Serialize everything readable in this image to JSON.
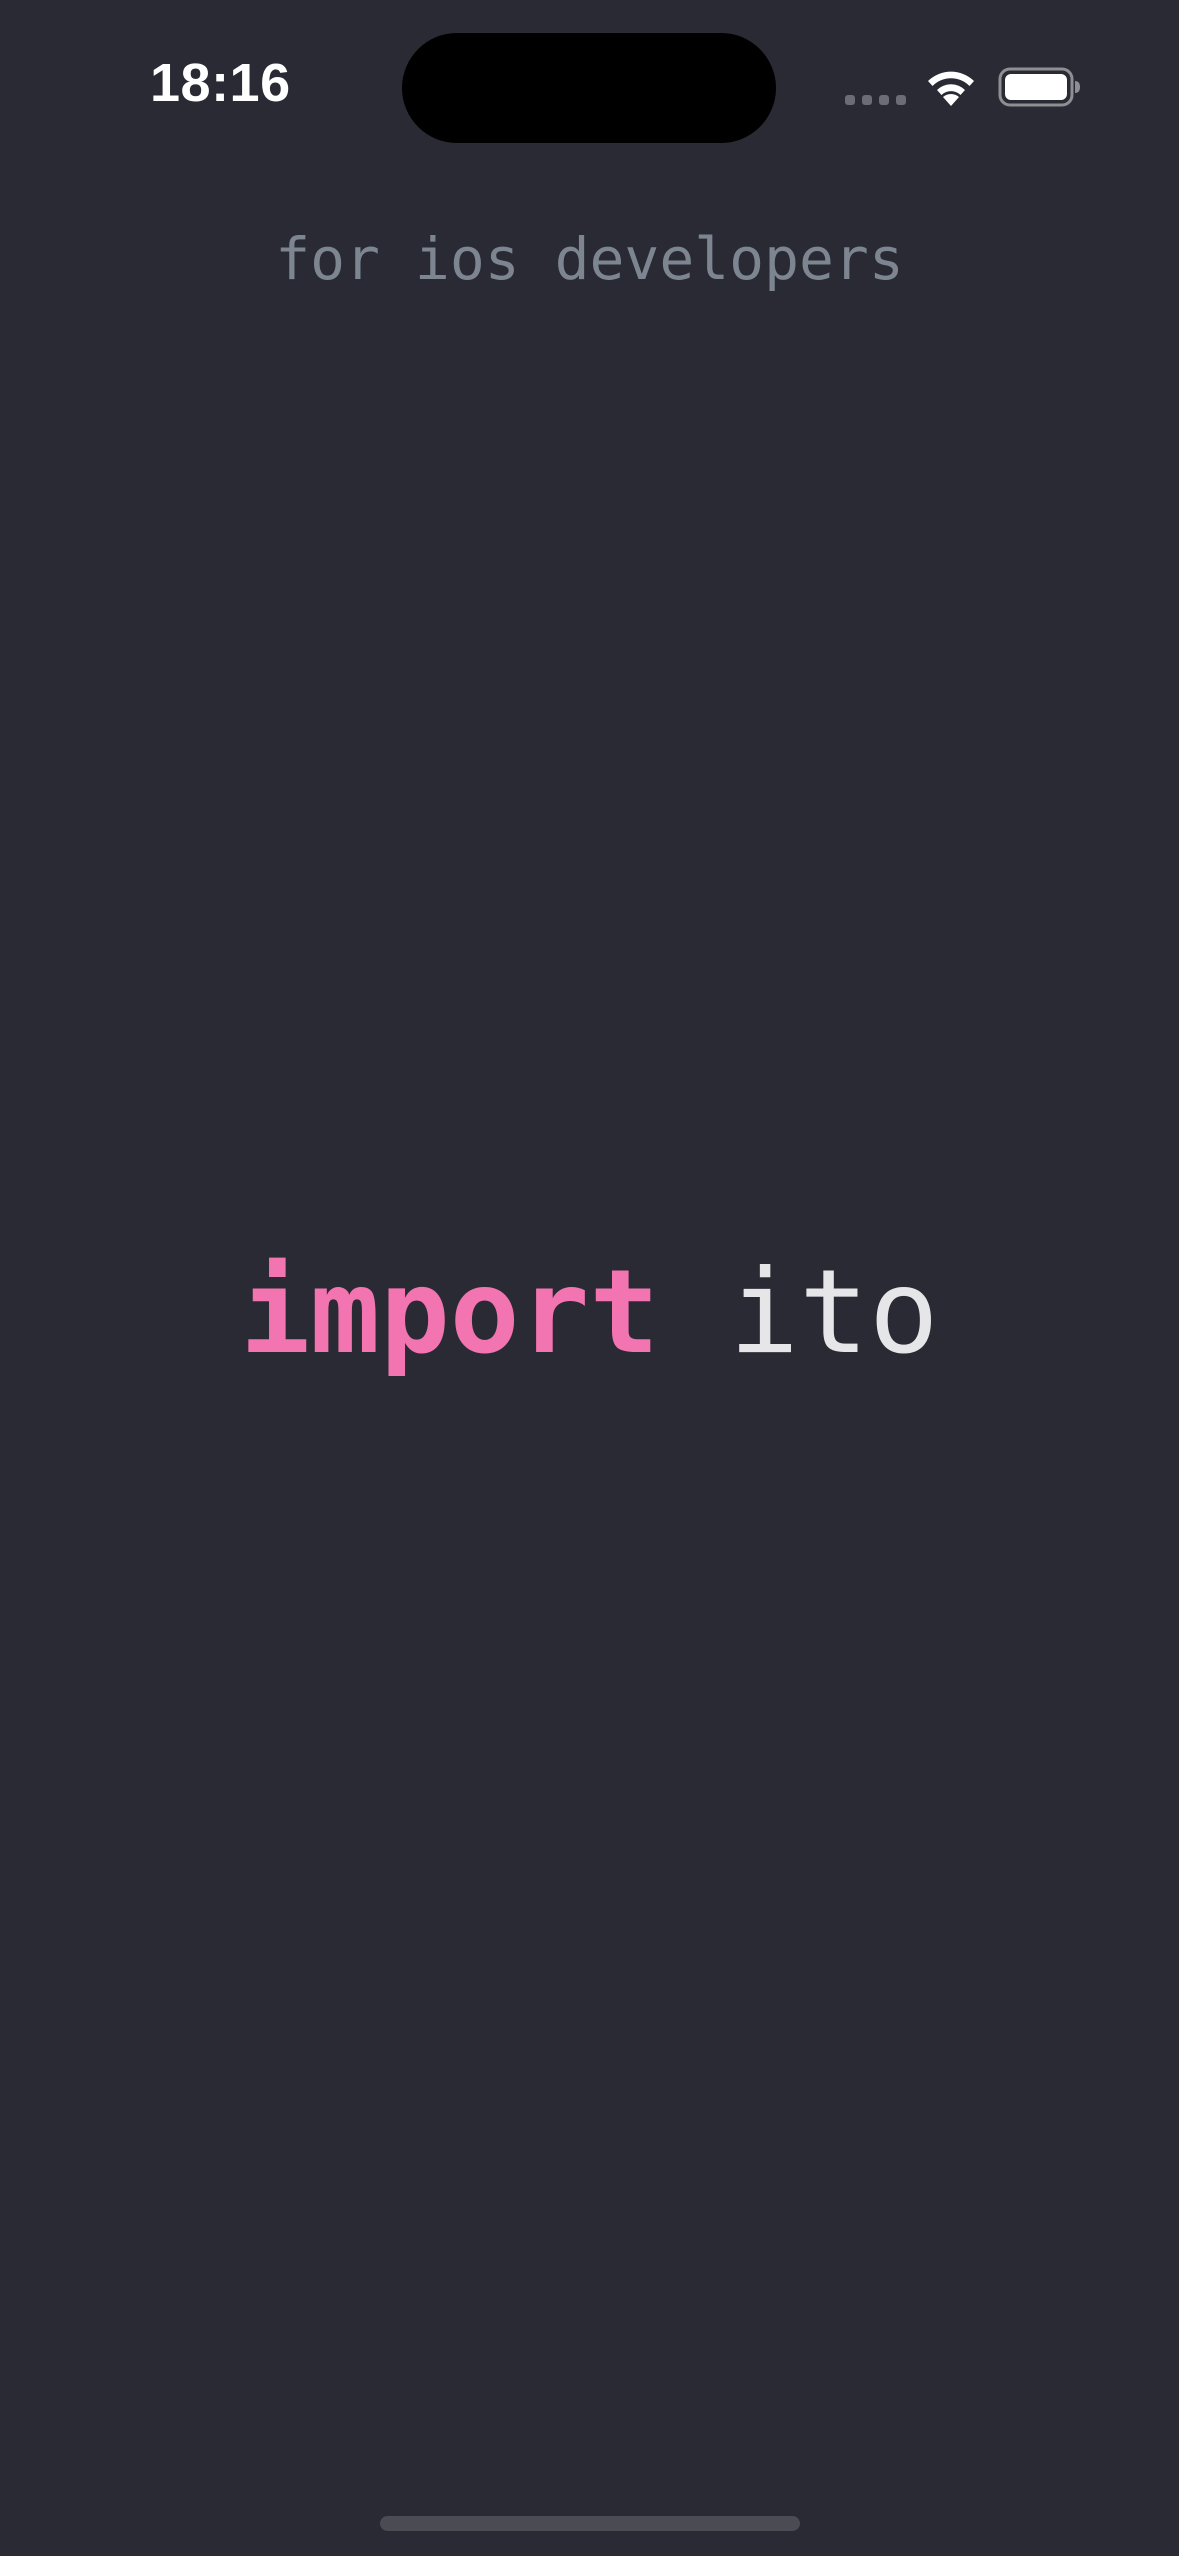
{
  "status_bar": {
    "time": "18:16",
    "icons": [
      "cellular-signal-icon",
      "wifi-icon",
      "battery-icon"
    ]
  },
  "tagline": "for ios developers",
  "wordmark": {
    "keyword": "import",
    "module": "ito"
  },
  "colors": {
    "background": "#292a33",
    "keyword": "#f274b1",
    "module": "#e6e6e8",
    "tagline": "#7d8590"
  }
}
